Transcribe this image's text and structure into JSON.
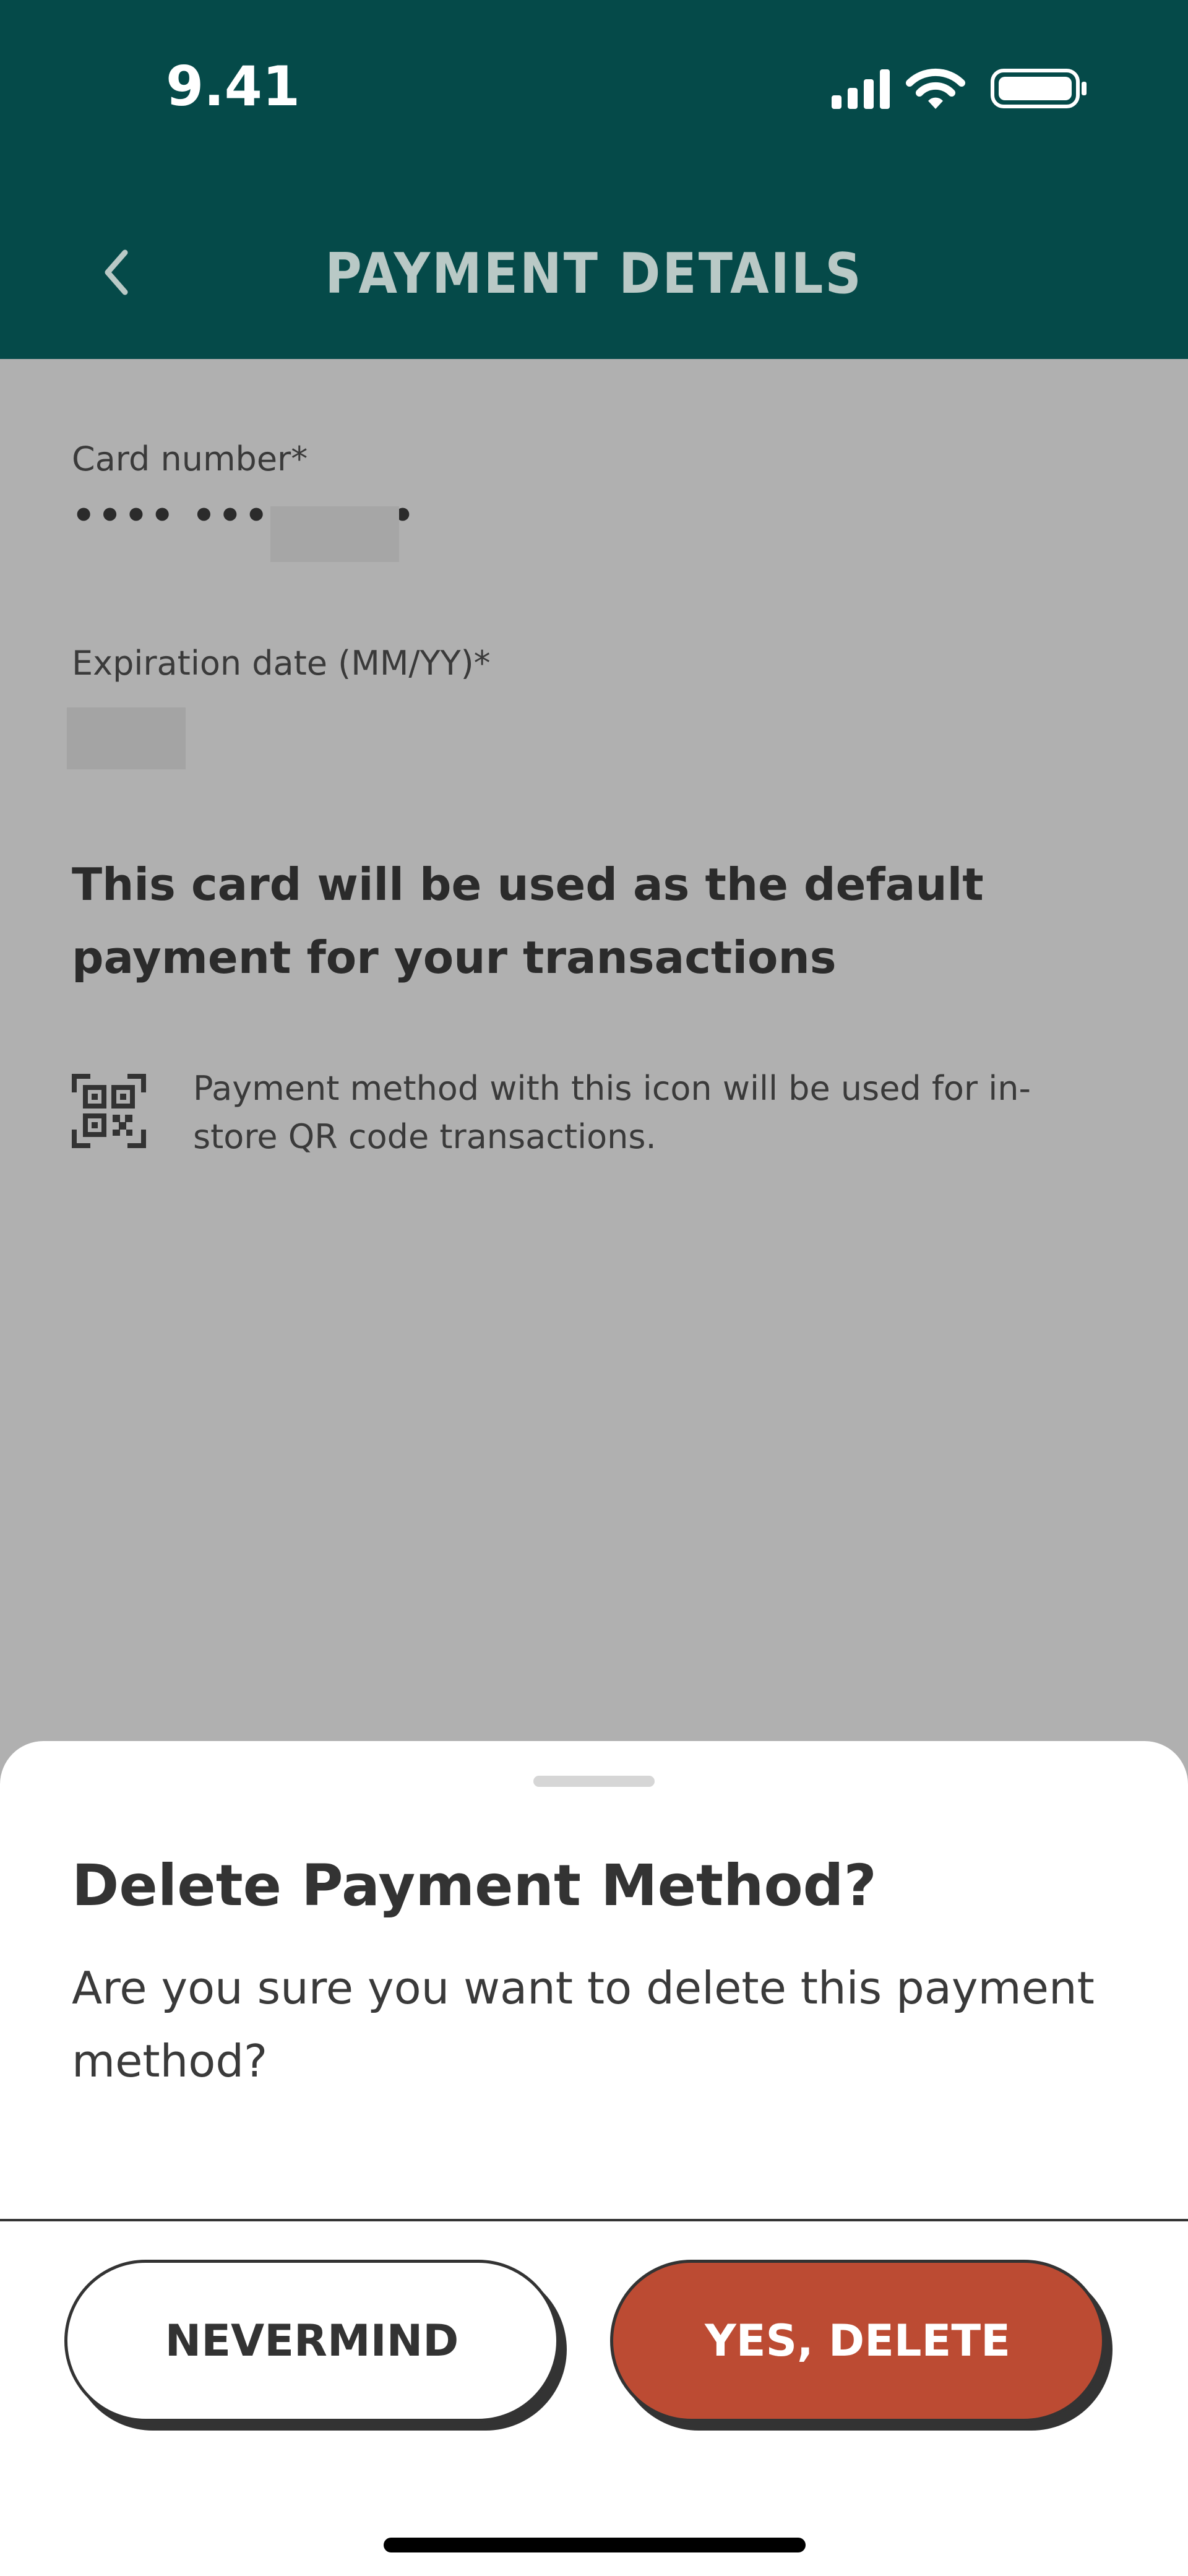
{
  "status_bar": {
    "time": "9.41",
    "icons": [
      "signal-icon",
      "wifi-icon",
      "battery-icon"
    ]
  },
  "header": {
    "title": "PAYMENT DETAILS",
    "back_icon": "chevron-left-icon"
  },
  "form": {
    "card_number_label": "Card number*",
    "card_number_value": "•••• •••• ••••",
    "expiration_label": "Expiration date (MM/YY)*",
    "default_message": "This card will be used as the default payment for your transactions",
    "qr_note": "Payment method with this icon will be used for in-store QR code transactions.",
    "qr_icon": "qr-code-icon"
  },
  "dialog": {
    "title": "Delete Payment Method?",
    "message": "Are you sure you want to delete this payment method?",
    "cancel_label": "NEVERMIND",
    "confirm_label": "YES, DELETE"
  },
  "colors": {
    "header_bg": "#054a49",
    "overlay_bg": "#b0b0b0",
    "delete_button": "#bc4b33"
  }
}
